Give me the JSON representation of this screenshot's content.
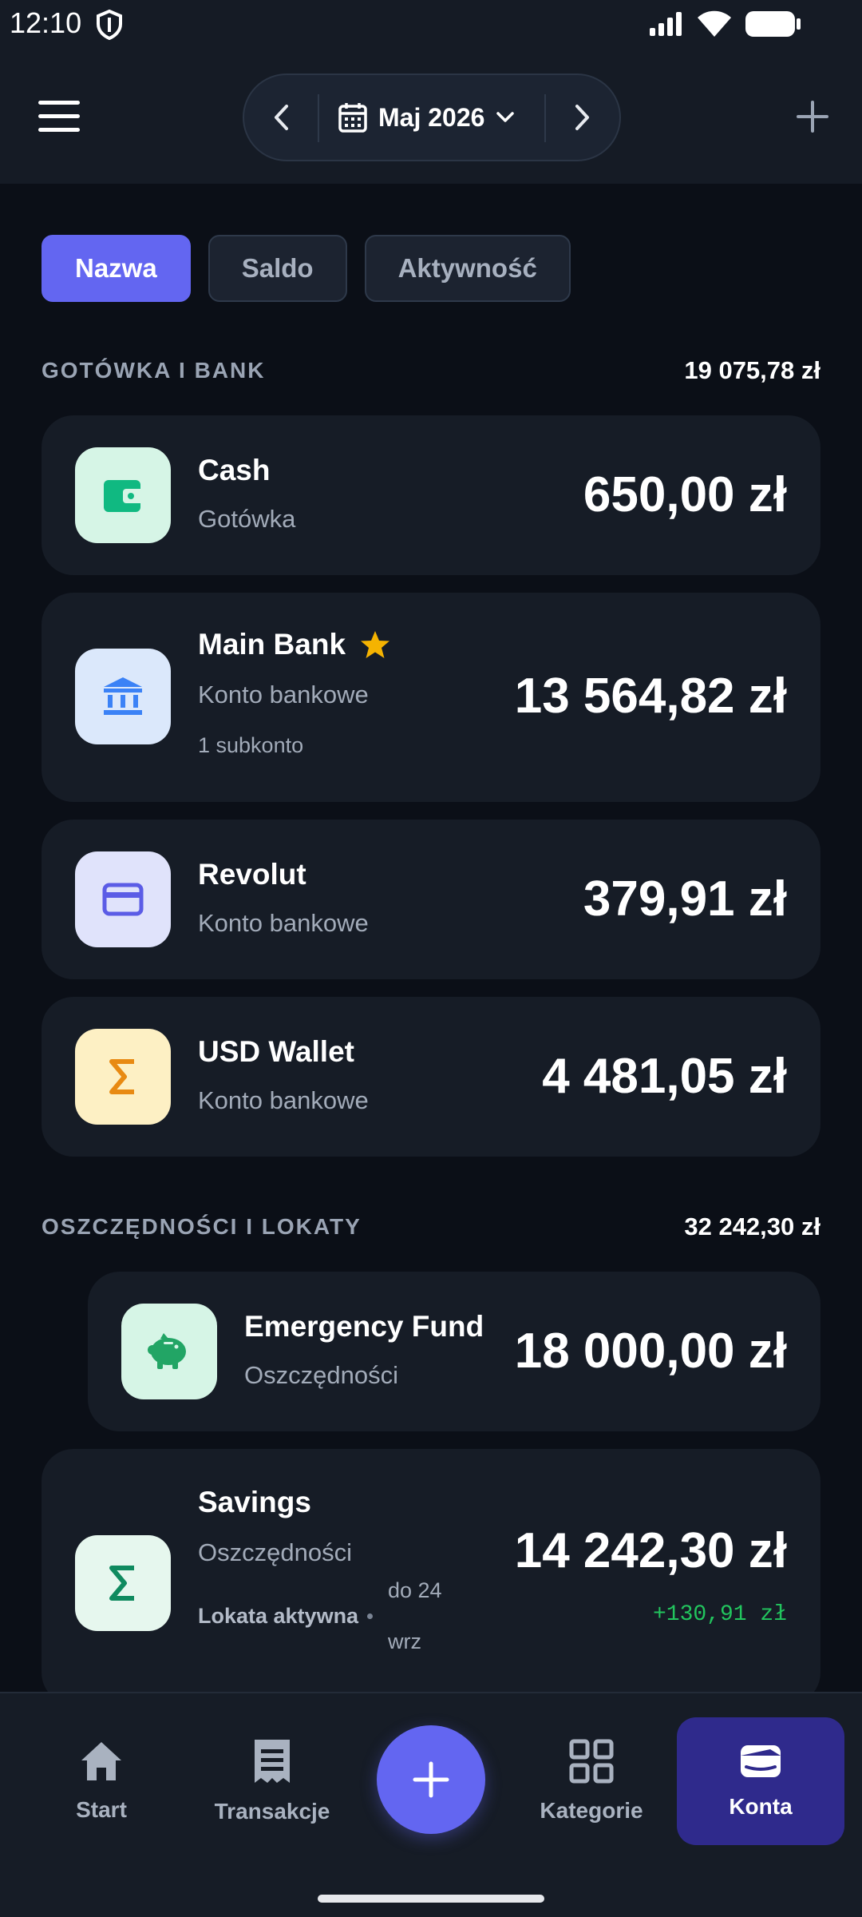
{
  "status_bar": {
    "time": "12:10"
  },
  "header": {
    "month_label": "Maj 2026"
  },
  "sort_tabs": [
    {
      "label": "Nazwa",
      "active": true
    },
    {
      "label": "Saldo",
      "active": false
    },
    {
      "label": "Aktywność",
      "active": false
    }
  ],
  "sections": [
    {
      "title": "GOTÓWKA I BANK",
      "total": "19 075,78 zł",
      "accounts": [
        {
          "name": "Cash",
          "type": "Gotówka",
          "balance": "650,00 zł",
          "icon": "wallet-icon",
          "icon_bg": "#d6f5e6",
          "icon_color": "#10b981"
        },
        {
          "name": "Main Bank",
          "type": "Konto bankowe",
          "subaccounts": "1 subkonto",
          "balance": "13 564,82 zł",
          "icon": "bank-icon",
          "favorite": true,
          "icon_bg": "#dbe8fb",
          "icon_color": "#3b82f6"
        },
        {
          "name": "Revolut",
          "type": "Konto bankowe",
          "balance": "379,91 zł",
          "icon": "credit-card-icon",
          "icon_bg": "#e0e3fb",
          "icon_color": "#5b5ce6"
        },
        {
          "name": "USD Wallet",
          "type": "Konto bankowe",
          "balance": "4 481,05 zł",
          "icon": "sigma-icon",
          "icon_bg": "#fdf0c4",
          "icon_color": "#e88a12"
        }
      ]
    },
    {
      "title": "OSZCZĘDNOŚCI I LOKATY",
      "total": "32 242,30 zł",
      "accounts": [
        {
          "name": "Emergency Fund",
          "type": "Oszczędności",
          "balance": "18 000,00 zł",
          "icon": "piggy-bank-icon",
          "icon_bg": "#d6f5e6",
          "icon_color": "#22a565"
        },
        {
          "name": "Savings",
          "type": "Oszczędności",
          "balance": "14 242,30 zł",
          "icon": "sigma-icon",
          "icon_bg": "#e6f7ee",
          "icon_color": "#0f8a5f",
          "deposit_status": "Lokata aktywna",
          "deposit_until_1": "do 24",
          "deposit_until_2": "wrz",
          "interest": "+130,91 zł"
        }
      ]
    }
  ],
  "bottom_nav": [
    {
      "label": "Start",
      "icon": "home-icon",
      "active": false
    },
    {
      "label": "Transakcje",
      "icon": "receipt-icon",
      "active": false
    },
    {
      "label": "Kategorie",
      "icon": "grid-icon",
      "active": false
    },
    {
      "label": "Konta",
      "icon": "wallet-card-icon",
      "active": true
    }
  ],
  "colors": {
    "accent": "#6366f1",
    "positive": "#22c55e",
    "favorite": "#f5b301"
  }
}
